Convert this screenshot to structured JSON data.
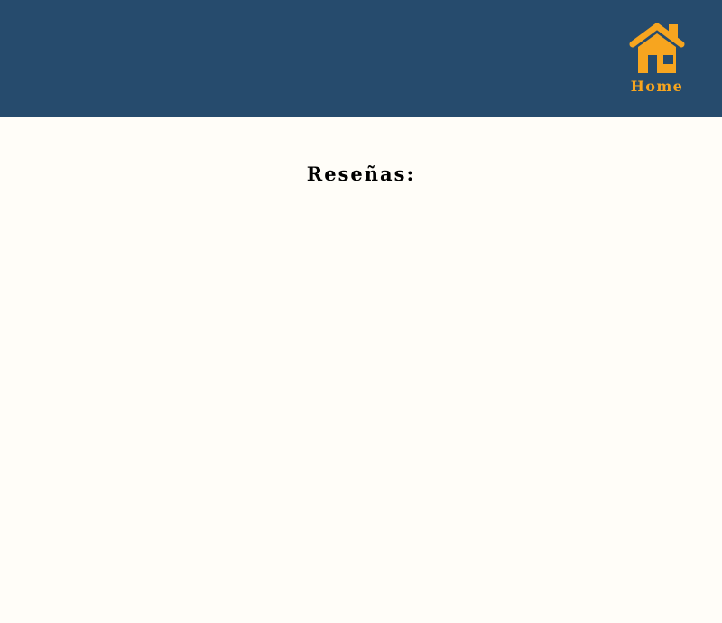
{
  "header": {
    "home_link": {
      "label": "Home",
      "icon": "house-icon",
      "color": "#f7a51f"
    },
    "background_color": "#264b6d"
  },
  "main": {
    "reviews_title": "Reseñas:",
    "background_color": "#fffdf8"
  }
}
